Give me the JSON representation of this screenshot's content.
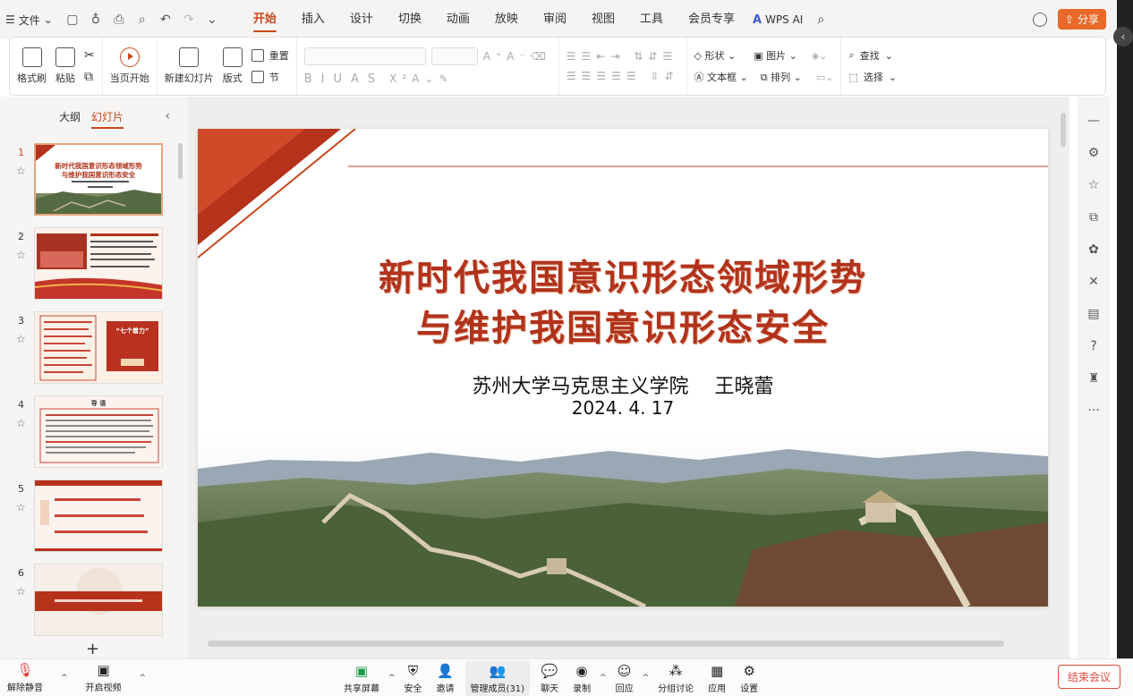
{
  "menubar": {
    "file_label": "文件",
    "tabs": [
      "开始",
      "插入",
      "设计",
      "切换",
      "动画",
      "放映",
      "审阅",
      "视图",
      "工具",
      "会员专享"
    ],
    "active_tab": "开始",
    "wps_ai": "WPS AI",
    "share": "分享"
  },
  "ribbon": {
    "format_painter": "格式刷",
    "paste": "粘贴",
    "play_from_current": "当页开始",
    "new_slide": "新建幻灯片",
    "layout": "版式",
    "reset": "重置",
    "section": "节",
    "shape": "形状",
    "picture": "图片",
    "textbox": "文本框",
    "arrange": "排列",
    "find": "查找",
    "select": "选择"
  },
  "panel": {
    "outline_tab": "大纲",
    "slides_tab": "幻灯片",
    "active_tab": "幻灯片",
    "slides": [
      {
        "num": "1",
        "title_l1": "新时代我国意识形态领域形势",
        "title_l2": "与维护我国意识形态安全"
      },
      {
        "num": "2"
      },
      {
        "num": "3",
        "badge": "“七个着力”"
      },
      {
        "num": "4",
        "heading": "导 语"
      },
      {
        "num": "5"
      },
      {
        "num": "6"
      }
    ]
  },
  "slide": {
    "title_line1": "新时代我国意识形态领域形势",
    "title_line2": "与维护我国意识形态安全",
    "author": "苏州大学马克思主义学院　 王晓蕾",
    "date": "2024. 4. 17"
  },
  "meeting": {
    "mute": "解除静音",
    "video": "开启视频",
    "share_screen": "共享屏幕",
    "security": "安全",
    "invite": "邀请",
    "members": "管理成员(31)",
    "chat": "聊天",
    "record": "录制",
    "react": "回应",
    "breakout": "分组讨论",
    "apps": "应用",
    "settings": "设置",
    "end": "结束会议"
  },
  "colors": {
    "accent": "#c8491b",
    "title_red": "#b1331c",
    "share_orange": "#e8692a",
    "end_red": "#e04a3f"
  }
}
